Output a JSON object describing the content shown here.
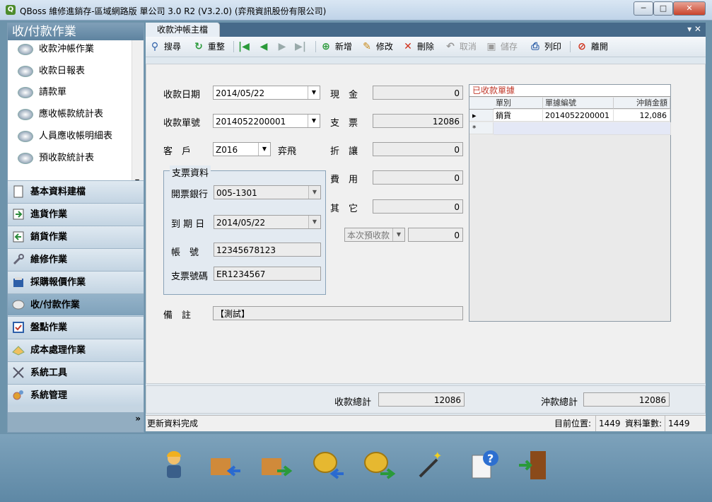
{
  "window": {
    "title": "QBoss 維修進銷存-區域網路版 單公司 3.0 R2 (V3.2.0) (弈飛資訊股份有限公司)",
    "buttons": {
      "minimize": "─",
      "maximize": "□",
      "close": "✕"
    }
  },
  "sidebar": {
    "header": "收/付款作業",
    "items": [
      "收款沖帳作業",
      "收款日報表",
      "請款單",
      "應收帳款統計表",
      "人員應收帳明細表",
      "預收款統計表"
    ],
    "categories": [
      {
        "label": "基本資料建檔",
        "icon": "document-icon"
      },
      {
        "label": "進貨作業",
        "icon": "inbound-icon"
      },
      {
        "label": "銷貨作業",
        "icon": "outbound-icon"
      },
      {
        "label": "維修作業",
        "icon": "wrench-icon"
      },
      {
        "label": "採購報價作業",
        "icon": "clipboard-icon"
      },
      {
        "label": "收/付款作業",
        "icon": "coin-icon"
      },
      {
        "label": "盤點作業",
        "icon": "checklist-icon"
      },
      {
        "label": "成本處理作業",
        "icon": "calculator-icon"
      },
      {
        "label": "系統工具",
        "icon": "tools-icon"
      },
      {
        "label": "系統管理",
        "icon": "gears-icon"
      }
    ],
    "more_label": "»"
  },
  "tab": {
    "label": "收款沖帳主檔",
    "controls": "▾ ✕"
  },
  "toolbar": {
    "search": "搜尋",
    "reset": "重整",
    "add": "新增",
    "edit": "修改",
    "delete": "刪除",
    "cancel": "取消",
    "save": "儲存",
    "print": "列印",
    "exit": "離開"
  },
  "form": {
    "date_label": "收款日期",
    "date_value": "2014/05/22",
    "no_label": "收款單號",
    "no_value": "2014052200001",
    "customer_label": "客　戶",
    "customer_code": "Z016",
    "customer_name": "弈飛",
    "cheque_group": "支票資料",
    "bank_label": "開票銀行",
    "bank_value": "005-1301",
    "due_label": "到 期 日",
    "due_value": "2014/05/22",
    "account_label": "帳　號",
    "account_value": "12345678123",
    "cheque_no_label": "支票號碼",
    "cheque_no_value": "ER1234567",
    "memo_label": "備　註",
    "memo_value": "【測試】",
    "cash_label": "現　金",
    "cash_value": "0",
    "check_label": "支　票",
    "check_value": "12086",
    "discount_label": "折　讓",
    "discount_value": "0",
    "fee_label": "費　用",
    "fee_value": "0",
    "other_label": "其　它",
    "other_value": "0",
    "prepay_label": "本次預收款",
    "prepay_value": "0"
  },
  "grid": {
    "caption": "已收款單據",
    "columns": [
      "單別",
      "單據編號",
      "沖銷金額"
    ],
    "rows": [
      [
        "銷貨",
        "2014052200001",
        "12,086"
      ]
    ],
    "new_row_marker": "*",
    "current_row_marker": "▸"
  },
  "totals": {
    "received_label": "收款總計",
    "received_value": "12086",
    "offset_label": "沖款總計",
    "offset_value": "12086"
  },
  "status": {
    "message": "更新資料完成",
    "position_label": "目前位置:",
    "position_value": "1449",
    "count_label": "資料筆數:",
    "count_value": "1449"
  },
  "dock": [
    "worker-icon",
    "inbound-boxes-icon",
    "outbound-boxes-icon",
    "coins-in-icon",
    "coins-out-icon",
    "magic-wand-icon",
    "help-document-icon",
    "exit-door-icon"
  ]
}
